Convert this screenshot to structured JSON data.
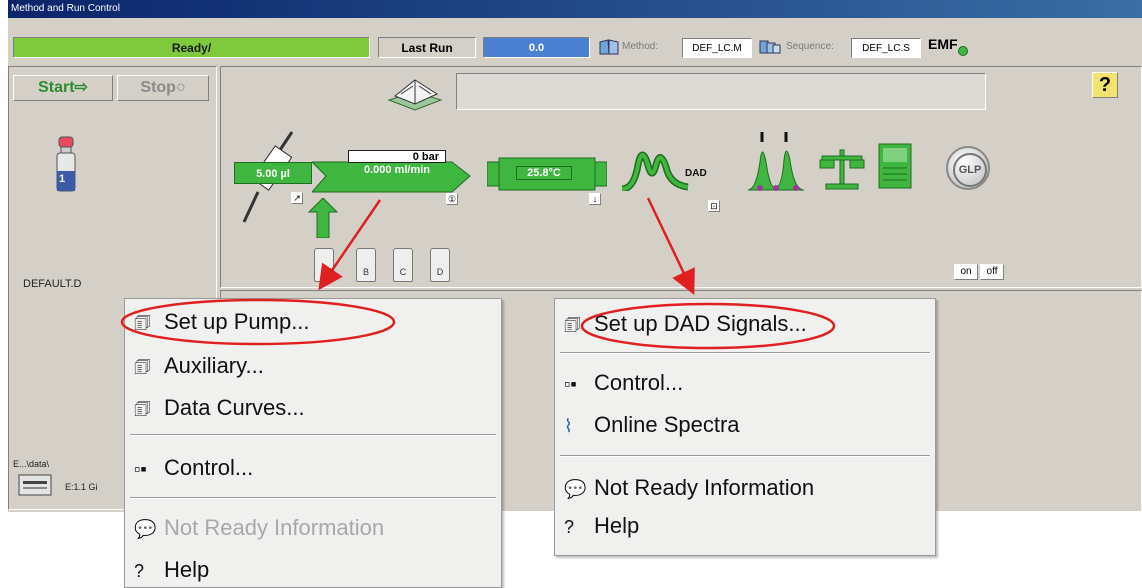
{
  "window": {
    "title": "Method and Run Control"
  },
  "status": {
    "ready": "Ready/",
    "last_run_label": "Last Run",
    "last_run_value": "0.0",
    "method_label": "Method:",
    "method_value": "DEF_LC.M",
    "sequence_label": "Sequence:",
    "sequence_value": "DEF_LC.S",
    "emf_label": "EMF"
  },
  "left": {
    "start_label": "Start⇨",
    "stop_label": "Stop○",
    "vial_number": "1",
    "data_file": "DEFAULT.D",
    "data_path": "E...\\data\\",
    "disk_label": "E:1.1 Gi"
  },
  "instrument": {
    "injector_volume": "5.00 µl",
    "pump_pressure": "0 bar",
    "pump_flow": "0.000 ml/min",
    "column_temp": "25.8°C",
    "dad_label": "DAD",
    "glp_label": "GLP",
    "help_symbol": "?",
    "bottles": [
      "A",
      "B",
      "C",
      "D"
    ],
    "on_label": "on",
    "off_label": "off"
  },
  "pump_menu": {
    "items": [
      {
        "label": "Set up Pump...",
        "icon": "pump-setup-icon"
      },
      {
        "label": "Auxiliary...",
        "icon": "auxiliary-icon"
      },
      {
        "label": "Data Curves...",
        "icon": "data-curves-icon"
      },
      {
        "label": "Control...",
        "icon": "control-icon"
      },
      {
        "label": "Not Ready Information",
        "icon": "not-ready-icon",
        "disabled": true
      },
      {
        "label": "Help",
        "icon": "help-icon"
      }
    ]
  },
  "dad_menu": {
    "items": [
      {
        "label": "Set up DAD Signals...",
        "icon": "dad-setup-icon"
      },
      {
        "label": "Control...",
        "icon": "control-icon"
      },
      {
        "label": "Online Spectra",
        "icon": "spectra-icon"
      },
      {
        "label": "Not Ready Information",
        "icon": "not-ready-icon"
      },
      {
        "label": "Help",
        "icon": "help-icon"
      }
    ]
  },
  "colors": {
    "accent_green": "#3fb63f",
    "ready_green": "#7ec93c",
    "last_run_blue": "#4a7fd1",
    "annotation_red": "#e02020"
  }
}
